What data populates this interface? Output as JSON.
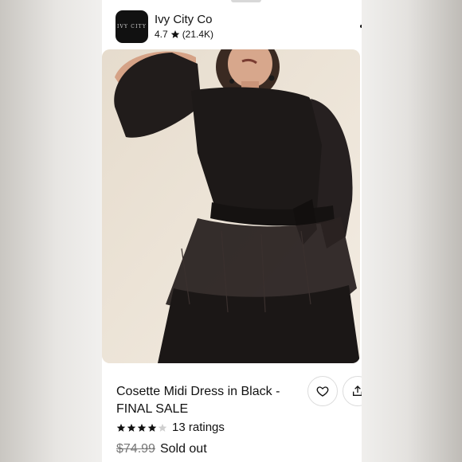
{
  "store": {
    "logo_text": "IVY CITY",
    "name": "Ivy City Co",
    "rating": "4.7",
    "rating_count": "(21.4K)"
  },
  "product": {
    "image_icon": "product-photo-black-midi-dress",
    "title": "Cosette Midi Dress in Black - FINAL SALE",
    "star_rating": 4,
    "ratings_label": "13 ratings",
    "price": "$74.99",
    "status": "Sold out"
  },
  "actions": {
    "favorite_icon": "heart-icon",
    "share_icon": "share-icon"
  },
  "colors": {
    "background": "#ffffff",
    "text": "#111111",
    "muted_price": "#777777",
    "dress": "#1d1918",
    "photo_backdrop": "#ece3d6"
  }
}
